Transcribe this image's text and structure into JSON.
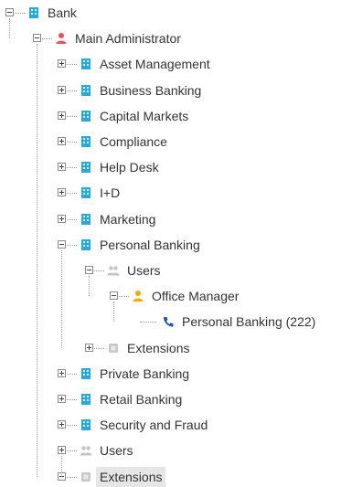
{
  "tree": {
    "nodes": [
      {
        "id": "bank",
        "depth": 0,
        "label": "Bank",
        "icon": "building-icon",
        "toggle": "minus"
      },
      {
        "id": "main-admin",
        "depth": 1,
        "label": "Main Administrator",
        "icon": "user-red-icon",
        "toggle": "minus"
      },
      {
        "id": "asset-management",
        "depth": 2,
        "label": "Asset Management",
        "icon": "building-icon",
        "toggle": "plus"
      },
      {
        "id": "business-banking",
        "depth": 2,
        "label": "Business Banking",
        "icon": "building-icon",
        "toggle": "plus"
      },
      {
        "id": "capital-markets",
        "depth": 2,
        "label": "Capital Markets",
        "icon": "building-icon",
        "toggle": "plus"
      },
      {
        "id": "compliance",
        "depth": 2,
        "label": "Compliance",
        "icon": "building-icon",
        "toggle": "plus"
      },
      {
        "id": "help-desk",
        "depth": 2,
        "label": "Help Desk",
        "icon": "building-icon",
        "toggle": "plus"
      },
      {
        "id": "i-d",
        "depth": 2,
        "label": "I+D",
        "icon": "building-icon",
        "toggle": "plus"
      },
      {
        "id": "marketing",
        "depth": 2,
        "label": "Marketing",
        "icon": "building-icon",
        "toggle": "plus"
      },
      {
        "id": "personal-banking",
        "depth": 2,
        "label": "Personal Banking",
        "icon": "building-icon",
        "toggle": "minus"
      },
      {
        "id": "pb-users",
        "depth": 3,
        "label": "Users",
        "icon": "users-icon",
        "toggle": "minus"
      },
      {
        "id": "office-manager",
        "depth": 4,
        "label": "Office Manager",
        "icon": "user-orange-icon",
        "toggle": "minus"
      },
      {
        "id": "pb-extension",
        "depth": 5,
        "label": "Personal Banking (222)",
        "icon": "phone-icon",
        "toggle": "none"
      },
      {
        "id": "pb-extensions",
        "depth": 3,
        "label": "Extensions",
        "icon": "extensions-icon",
        "toggle": "plus"
      },
      {
        "id": "private-banking",
        "depth": 2,
        "label": "Private Banking",
        "icon": "building-icon",
        "toggle": "plus"
      },
      {
        "id": "retail-banking",
        "depth": 2,
        "label": "Retail Banking",
        "icon": "building-icon",
        "toggle": "plus"
      },
      {
        "id": "security-fraud",
        "depth": 2,
        "label": "Security and Fraud",
        "icon": "building-icon",
        "toggle": "plus"
      },
      {
        "id": "root-users",
        "depth": 2,
        "label": "Users",
        "icon": "users-icon",
        "toggle": "plus"
      },
      {
        "id": "root-extensions",
        "depth": 2,
        "label": "Extensions",
        "icon": "extensions-icon",
        "toggle": "minus",
        "selected": true
      }
    ]
  },
  "colors": {
    "building": "#29a9d9",
    "user_red": "#e8505b",
    "user_orange": "#f2a900",
    "users_gray": "#c4c4c4",
    "phone": "#1e5aa0",
    "extensions_gray": "#c8c8c8",
    "selected_bg": "#e6e6e6",
    "text": "#333333"
  }
}
